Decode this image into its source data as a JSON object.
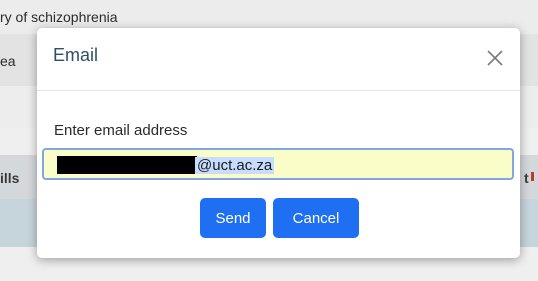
{
  "background": {
    "title_fragment": "ry of schizophrenia",
    "row_fragment": "ea",
    "header_left_fragment": "ills",
    "header_right_fragment": "t"
  },
  "modal": {
    "title": "Email",
    "close_icon": "close-icon",
    "field_label": "Enter email address",
    "email_visible_value": "@uct.ac.za",
    "send_label": "Send",
    "cancel_label": "Cancel",
    "colors": {
      "primary_button": "#1f6ff2",
      "input_background": "#fbfdc9",
      "input_border": "#7fa7e3",
      "title": "#2f4f67"
    }
  }
}
